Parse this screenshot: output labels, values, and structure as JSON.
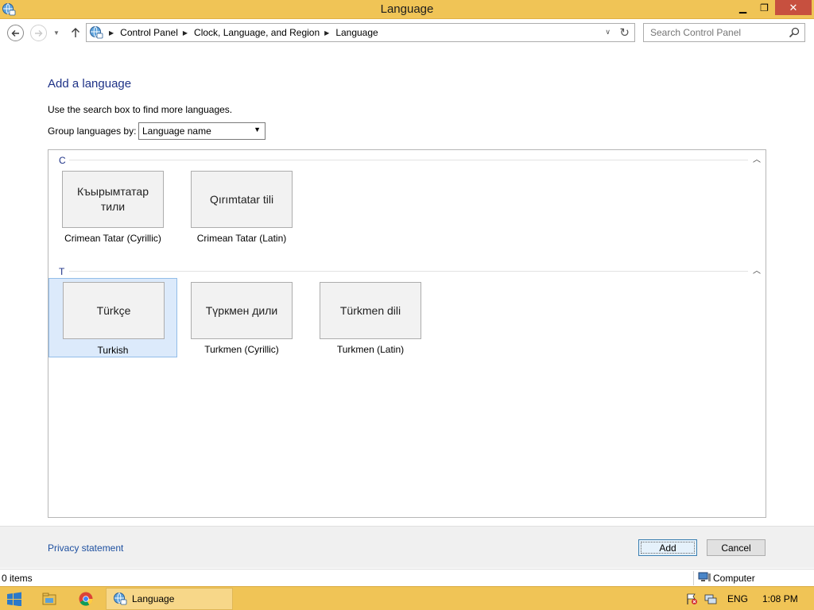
{
  "window": {
    "title": "Language",
    "minimize_glyph": "▁",
    "maximize_glyph": "❐",
    "close_glyph": "✕"
  },
  "address_bar": {
    "breadcrumbs": [
      "Control Panel",
      "Clock, Language, and Region",
      "Language"
    ]
  },
  "search": {
    "placeholder": "Search Control Panel"
  },
  "main": {
    "heading": "Add a language",
    "hint": "Use the search box to find more languages.",
    "group_by_label": "Group languages by:",
    "group_by_value": "Language name"
  },
  "groups": [
    {
      "letter": "C",
      "languages": [
        {
          "native": "Къырымтатар тили",
          "name": "Crimean Tatar (Cyrillic)",
          "selected": false
        },
        {
          "native": "Qırımtatar tili",
          "name": "Crimean Tatar (Latin)",
          "selected": false
        }
      ]
    },
    {
      "letter": "T",
      "languages": [
        {
          "native": "Türkçe",
          "name": "Turkish",
          "selected": true
        },
        {
          "native": "Түркмен дили",
          "name": "Turkmen (Cyrillic)",
          "selected": false
        },
        {
          "native": "Türkmen dili",
          "name": "Turkmen (Latin)",
          "selected": false
        }
      ]
    }
  ],
  "footer": {
    "privacy_link": "Privacy statement",
    "add_label": "Add",
    "cancel_label": "Cancel"
  },
  "status_bar": {
    "items_count": "0 items",
    "location": "Computer"
  },
  "taskbar": {
    "active_task": "Language",
    "language_indicator": "ENG",
    "clock": "1:08 PM"
  },
  "colors": {
    "title_bar": "#f0c456",
    "heading_text": "#1e3287",
    "link_text": "#1e50a0",
    "selection_fill": "#dceafb",
    "selection_border": "#93bde9"
  }
}
